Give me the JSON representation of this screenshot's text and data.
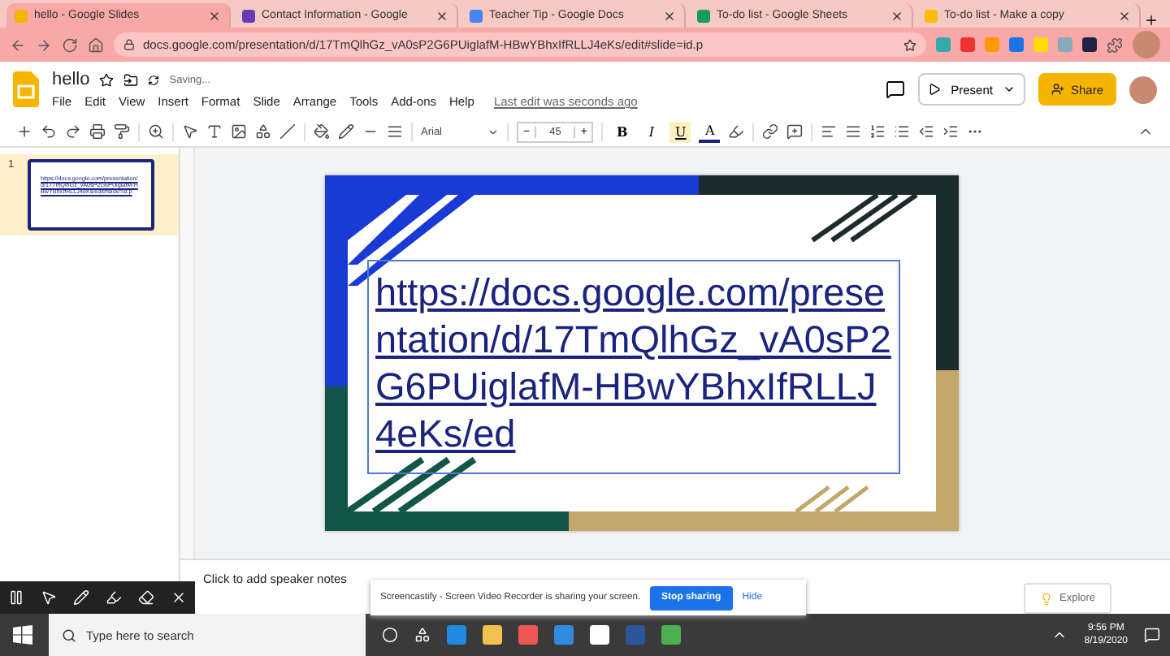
{
  "browser": {
    "tabs": [
      {
        "title": "hello - Google Slides",
        "selected": true,
        "color": "#f4b400"
      },
      {
        "title": "Contact Information - Google",
        "selected": false,
        "color": "#673ab7"
      },
      {
        "title": "Teacher Tip - Google Docs",
        "selected": false,
        "color": "#4285f4"
      },
      {
        "title": "To-do list - Google Sheets",
        "selected": false,
        "color": "#0f9d58"
      },
      {
        "title": "To-do list - Make a copy",
        "selected": false,
        "color": "#fbbc04"
      }
    ],
    "url": "docs.google.com/presentation/d/17TmQlhGz_vA0sP2G6PUiglafM-HBwYBhxIfRLLJ4eKs/edit#slide=id.p"
  },
  "app": {
    "doc_title": "hello",
    "save_status": "Saving...",
    "menu": [
      "File",
      "Edit",
      "View",
      "Insert",
      "Format",
      "Slide",
      "Arrange",
      "Tools",
      "Add-ons",
      "Help"
    ],
    "last_edit": "Last edit was seconds ago",
    "present": "Present",
    "share": "Share"
  },
  "toolbar": {
    "font": "Arial",
    "font_size": "45",
    "minus": "−",
    "plus": "+",
    "format_buttons": [
      {
        "kind": "bold",
        "label": "B",
        "on": false
      },
      {
        "kind": "italic",
        "label": "I",
        "on": false
      },
      {
        "kind": "underline",
        "label": "U",
        "on": true
      },
      {
        "kind": "color",
        "label": "A",
        "on": false
      }
    ]
  },
  "filmstrip": [
    {
      "number": "1",
      "selected": true,
      "text": "https://docs.google.com/presentation/d/17TmQlhGz_vA0sP2G6PUiglafM-HBwYBhxIfRLLJ4eKs/edit#slide=id.p"
    }
  ],
  "slide": {
    "link_text": "https://docs.google.com/presentation/d/17TmQlhGz_vA0sP2G6PUiglafM-HBwYBhxIfRLLJ4eKs/ed"
  },
  "speaker_notes": {
    "placeholder": "Click to add speaker notes"
  },
  "screencastify": {
    "message": "Screencastify - Screen Video Recorder is sharing your screen.",
    "stop": "Stop sharing",
    "hide": "Hide"
  },
  "explore": "Explore",
  "taskbar": {
    "search_placeholder": "Type here to search",
    "time": "9:56 PM",
    "date": "8/19/2020"
  }
}
